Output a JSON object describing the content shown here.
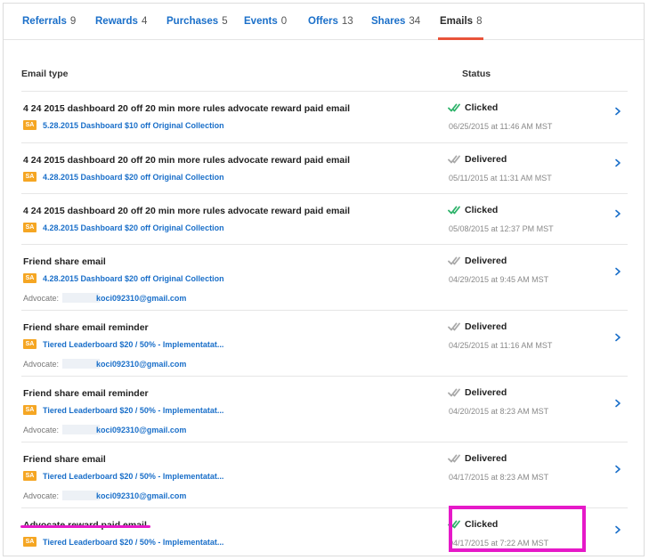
{
  "tabs": [
    {
      "label": "Referrals",
      "count": "9",
      "active": false
    },
    {
      "label": "Rewards",
      "count": "4",
      "active": false
    },
    {
      "label": "Purchases",
      "count": "5",
      "active": false
    },
    {
      "label": "Events",
      "count": "0",
      "active": false
    },
    {
      "label": "Offers",
      "count": "13",
      "active": false
    },
    {
      "label": "Shares",
      "count": "34",
      "active": false
    },
    {
      "label": "Emails",
      "count": "8",
      "active": true
    }
  ],
  "table": {
    "headers": {
      "email_type": "Email type",
      "status": "Status"
    },
    "badge_label": "SA",
    "advocate_label": "Advocate:",
    "rows": [
      {
        "title": "4 24 2015 dashboard 20 off 20 min more rules advocate reward paid email",
        "campaign": "5.28.2015 Dashboard $10 off Original Collection",
        "advocate": "",
        "status": "Clicked",
        "date": "06/25/2015 at 11:46 AM MST"
      },
      {
        "title": "4 24 2015 dashboard 20 off 20 min more rules advocate reward paid email",
        "campaign": "4.28.2015 Dashboard $20 off Original Collection",
        "advocate": "",
        "status": "Delivered",
        "date": "05/11/2015 at 11:31 AM MST"
      },
      {
        "title": "4 24 2015 dashboard 20 off 20 min more rules advocate reward paid email",
        "campaign": "4.28.2015 Dashboard $20 off Original Collection",
        "advocate": "",
        "status": "Clicked",
        "date": "05/08/2015 at 12:37 PM MST"
      },
      {
        "title": "Friend share email",
        "campaign": "4.28.2015 Dashboard $20 off Original Collection",
        "advocate": "koci092310@gmail.com",
        "status": "Delivered",
        "date": "04/29/2015 at 9:45 AM MST"
      },
      {
        "title": "Friend share email reminder",
        "campaign": "Tiered Leaderboard $20 / 50% - Implementatat...",
        "advocate": "koci092310@gmail.com",
        "status": "Delivered",
        "date": "04/25/2015 at 11:16 AM MST"
      },
      {
        "title": "Friend share email reminder",
        "campaign": "Tiered Leaderboard $20 / 50% - Implementatat...",
        "advocate": "koci092310@gmail.com",
        "status": "Delivered",
        "date": "04/20/2015 at 8:23 AM MST"
      },
      {
        "title": "Friend share email",
        "campaign": "Tiered Leaderboard $20 / 50% - Implementatat...",
        "advocate": "koci092310@gmail.com",
        "status": "Delivered",
        "date": "04/17/2015 at 8:23 AM MST"
      },
      {
        "title": "Advocate reward paid email",
        "campaign": "Tiered Leaderboard $20 / 50% - Implementatat...",
        "advocate": "",
        "status": "Clicked",
        "date": "04/17/2015 at 7:22 AM MST"
      }
    ]
  },
  "colors": {
    "link": "#1a6fc9",
    "clicked_check": "#2fb36b",
    "delivered_check": "#a9a9a9",
    "active_tab_underline": "#e8533a",
    "badge": "#f5a623",
    "annotation": "#e619c8"
  },
  "icons": {
    "clicked": "check-double-icon",
    "delivered": "check-double-icon",
    "row_action": "chevron-right-icon"
  }
}
